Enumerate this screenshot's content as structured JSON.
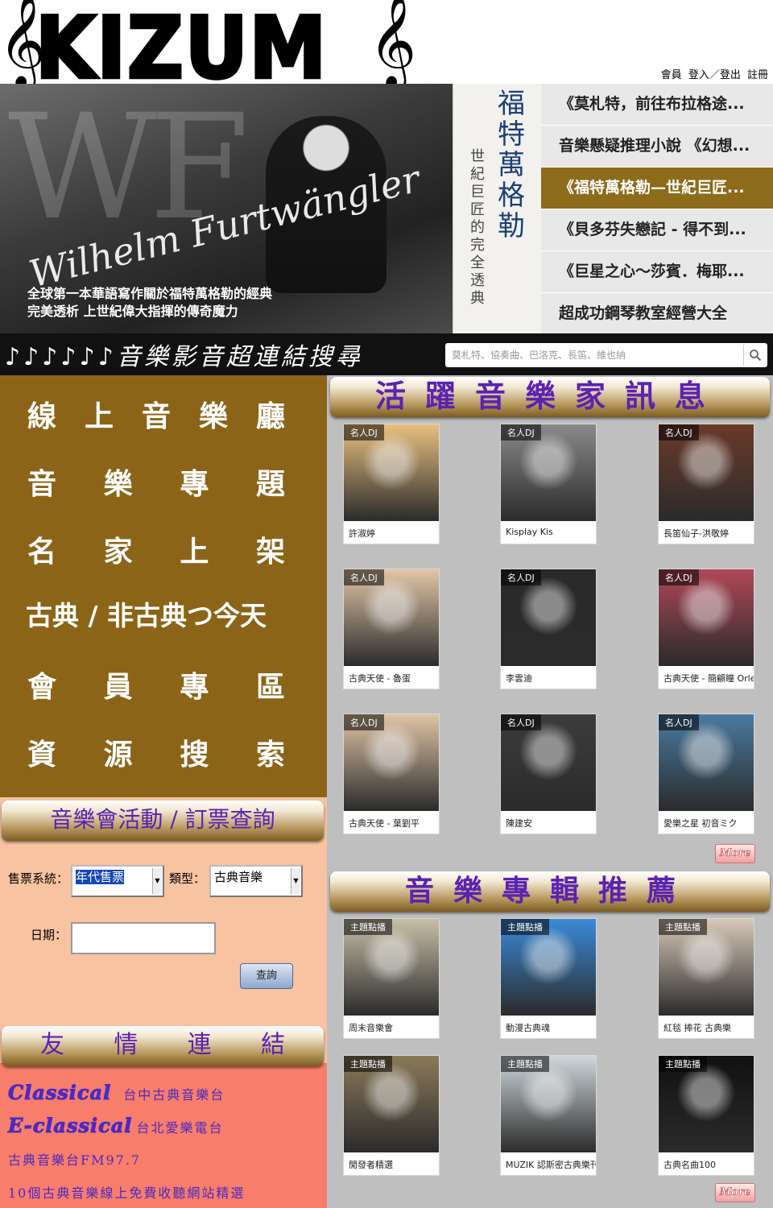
{
  "header": {
    "logo": "KIZUM",
    "clef_left": "𝄞",
    "clef_right": "𝄞",
    "member": "會員",
    "login": "登入／登出",
    "register": "註冊"
  },
  "banner": {
    "hero_caption_1": "全球第一本華語寫作關於福特萬格勒的經典",
    "hero_caption_2": "完美透析 上世紀偉大指揮的傳奇魔力",
    "hero_watermark": "WF",
    "hero_signature": "Wilhelm Furtwängler",
    "spine_title": "福特萬格勒",
    "spine_subtitle": "世紀巨匠的完全透典",
    "books": [
      {
        "label": "《莫札特，前往布拉格途..."
      },
      {
        "label": "音樂懸疑推理小說 《幻想..."
      },
      {
        "label": "《福特萬格勒—世紀巨匠..."
      },
      {
        "label": "《貝多芬失戀記 - 得不到..."
      },
      {
        "label": "《巨星之心～莎賓．梅耶..."
      },
      {
        "label": "超成功鋼琴教室經營大全"
      }
    ],
    "active_book": 2
  },
  "search": {
    "title": "♪♪♪♪♪♪音樂影音超連結搜尋",
    "placeholder": "莫札特、協奏曲、巴洛克、長笛、維也納"
  },
  "nav": [
    {
      "label": "線上音樂廳"
    },
    {
      "label": "音樂專題"
    },
    {
      "label": "名家上架"
    },
    {
      "label": "古典 / 非古典つ今天"
    },
    {
      "label": "會員專區"
    },
    {
      "label": "資源搜索"
    }
  ],
  "concert": {
    "title": "音樂會活動 / 訂票查詢",
    "system_label": "售票系統：",
    "system_value": "年代售票",
    "type_label": "類型：",
    "type_value": "古典音樂",
    "date_label": "日期：",
    "date_value": "",
    "query_button": "查詢"
  },
  "links": {
    "title": "友情連結",
    "items": [
      {
        "big": "Classical",
        "small": "台中古典音樂台"
      },
      {
        "big": "E-classical",
        "small": "台北愛樂電台"
      },
      {
        "big": "",
        "small": "古典音樂台FM97.7"
      },
      {
        "big": "",
        "small": "10個古典音樂線上免費收聽網站精選"
      }
    ]
  },
  "musicians": {
    "title": "活躍音樂家訊息",
    "tag": "名人DJ",
    "items": [
      {
        "name": "許淑婷",
        "color": "#e8c080"
      },
      {
        "name": "Kisplay Kis",
        "color": "#8a8a8a"
      },
      {
        "name": "長笛仙子-洪敬婷",
        "color": "#6a3a2a"
      },
      {
        "name": "古典天使 - 魯蛋",
        "color": "#e2c6a8"
      },
      {
        "name": "李雲迪",
        "color": "#2a2a2a"
      },
      {
        "name": "古典天使 - 簡顧瞳 Orleum CHIEN",
        "color": "#b04858"
      },
      {
        "name": "古典天使 - 葉劉平",
        "color": "#e0c4a6"
      },
      {
        "name": "陳建安",
        "color": "#3c3c3c"
      },
      {
        "name": "愛樂之星 初音ミク",
        "color": "#4a7aa0"
      }
    ],
    "more": "More"
  },
  "albums": {
    "title": "音樂專輯推薦",
    "tag": "主題點播",
    "items": [
      {
        "name": "周末音樂會",
        "color": "#c8bfa8"
      },
      {
        "name": "動漫古典魂",
        "color": "#3a8ad8"
      },
      {
        "name": "紅毯 捧花 古典樂",
        "color": "#d8c8b8"
      },
      {
        "name": "閒發者精選",
        "color": "#8a7a5a"
      },
      {
        "name": "MUZIK 認斯密古典樂刊",
        "color": "#cfd8dc"
      },
      {
        "name": "古典名曲100",
        "color": "#111111"
      }
    ],
    "more": "More"
  }
}
